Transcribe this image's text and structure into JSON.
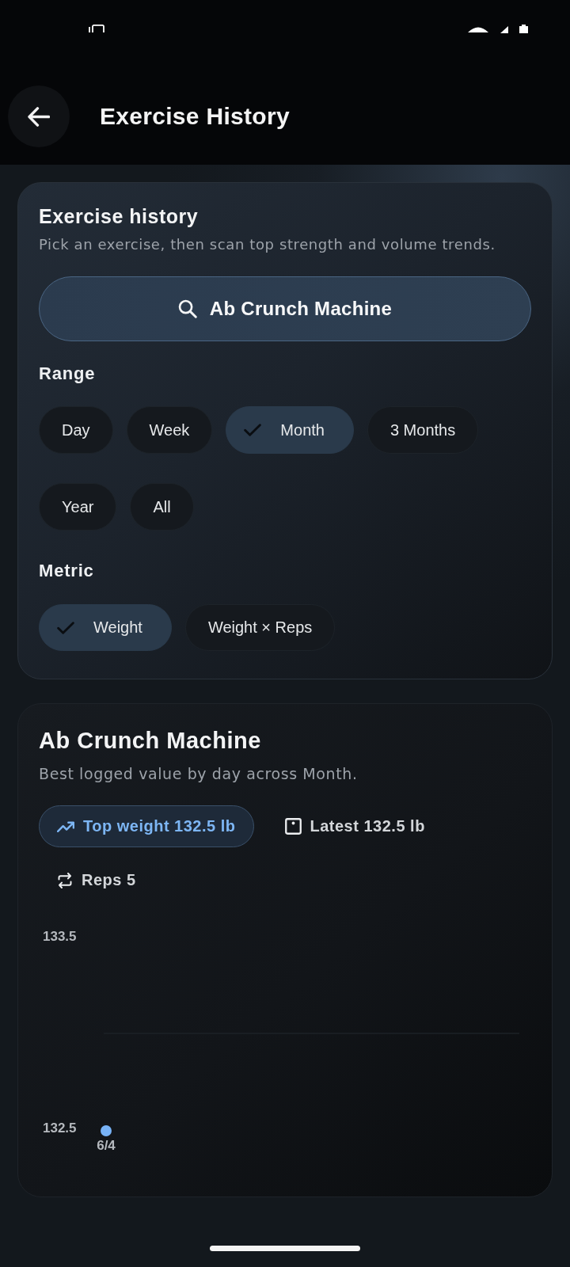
{
  "app_bar": {
    "title": "Exercise History"
  },
  "picker_card": {
    "title": "Exercise history",
    "subtitle": "Pick an exercise, then scan top strength and volume trends.",
    "exercise_button": {
      "label": "Ab Crunch Machine"
    },
    "range": {
      "label": "Range",
      "options": [
        {
          "label": "Day",
          "selected": false
        },
        {
          "label": "Week",
          "selected": false
        },
        {
          "label": "Month",
          "selected": true
        },
        {
          "label": "3 Months",
          "selected": false
        },
        {
          "label": "Year",
          "selected": false
        },
        {
          "label": "All",
          "selected": false
        }
      ]
    },
    "metric": {
      "label": "Metric",
      "options": [
        {
          "label": "Weight",
          "selected": true
        },
        {
          "label": "Weight × Reps",
          "selected": false
        }
      ]
    }
  },
  "chart_card": {
    "title": "Ab Crunch Machine",
    "subtitle": "Best logged value by day across Month.",
    "stats": [
      {
        "kind": "trend",
        "label": "Top weight 132.5 lb",
        "selected": true
      },
      {
        "kind": "latest",
        "label": "Latest 132.5 lb",
        "selected": false
      },
      {
        "kind": "reps",
        "label": "Reps 5",
        "selected": false
      }
    ],
    "chart_data": {
      "type": "scatter",
      "x": [
        "6/4"
      ],
      "series": [
        {
          "color": "#78b3f7",
          "values": [
            132.5
          ]
        }
      ],
      "ylim": [
        132.5,
        133.5
      ],
      "yticks": [
        132.5,
        133.5
      ]
    }
  }
}
